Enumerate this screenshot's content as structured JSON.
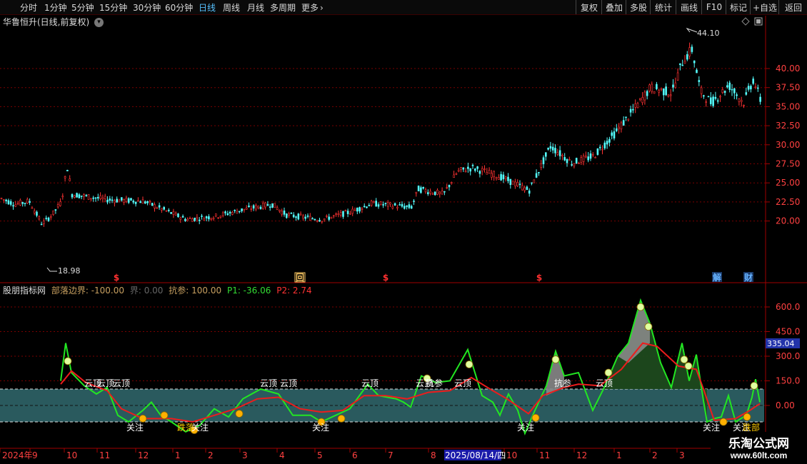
{
  "toolbar": {
    "periods": [
      {
        "label": "分时",
        "active": false
      },
      {
        "label": "1分钟",
        "active": false
      },
      {
        "label": "5分钟",
        "active": false
      },
      {
        "label": "15分钟",
        "active": false
      },
      {
        "label": "30分钟",
        "active": false
      },
      {
        "label": "60分钟",
        "active": false
      },
      {
        "label": "日线",
        "active": true
      },
      {
        "label": "周线",
        "active": false
      },
      {
        "label": "月线",
        "active": false
      },
      {
        "label": "多周期",
        "active": false
      },
      {
        "label": "更多",
        "active": false
      }
    ],
    "more_icon": "chevron-right-icon",
    "right_buttons": [
      "复权",
      "叠加",
      "多股",
      "统计",
      "画线",
      "F10",
      "标记",
      "+自选",
      "返回"
    ]
  },
  "main_chart": {
    "title": "华鲁恒升(日线,前复权)",
    "title_icon": "chevron-down-icon",
    "corner_icons": [
      "diamond-icon",
      "window-icon"
    ],
    "y_ticks": [
      "40.00",
      "37.50",
      "35.00",
      "32.50",
      "30.00",
      "27.50",
      "25.00",
      "22.50",
      "20.00"
    ],
    "high_label": "44.10",
    "low_label": "18.98",
    "markers": [
      {
        "symbol": "$",
        "color": "#ff3030"
      },
      {
        "symbol": "回",
        "color": "#ffcc66"
      },
      {
        "symbol": "$",
        "color": "#ff3030"
      },
      {
        "symbol": "$",
        "color": "#ff3030"
      },
      {
        "symbol": "解",
        "color": "#66b3ff"
      },
      {
        "symbol": "财",
        "color": "#66b3ff"
      }
    ],
    "colors": {
      "up": "#ff3232",
      "down": "#54fcfc",
      "grid": "#7a0000"
    }
  },
  "indicator": {
    "name": "股朋指标网",
    "params": [
      {
        "label": "部落边界: -100.00",
        "color": "#c8a060"
      },
      {
        "label": "界: 0.00",
        "color": "#666666"
      },
      {
        "label": "抗参: 100.00",
        "color": "#c8a060"
      },
      {
        "label": "P1: -36.06",
        "color": "#33dd33"
      },
      {
        "label": "P2: 2.74",
        "color": "#ff3333"
      }
    ],
    "y_ticks": [
      "600.0",
      "450.0",
      "300.0",
      "150.0",
      "0.00"
    ],
    "current_value": "335.04",
    "signals": [
      {
        "text": "云顶",
        "color": "#ffffff"
      },
      {
        "text": "云顶",
        "color": "#ffffff"
      },
      {
        "text": "云顶",
        "color": "#ffffff"
      },
      {
        "text": "云顶",
        "color": "#ffffff"
      },
      {
        "text": "云顶",
        "color": "#ffffff"
      },
      {
        "text": "云顶",
        "color": "#ffffff"
      },
      {
        "text": "云顶",
        "color": "#ffffff"
      },
      {
        "text": "云顶",
        "color": "#ffffff"
      },
      {
        "text": "云顶",
        "color": "#ffffff"
      },
      {
        "text": "抗参",
        "color": "#ffffff"
      },
      {
        "text": "抗参",
        "color": "#ffffff"
      },
      {
        "text": "关注",
        "color": "#ffffff"
      },
      {
        "text": "关注",
        "color": "#ffffff"
      },
      {
        "text": "跌落",
        "color": "#ffcc00"
      },
      {
        "text": "关注",
        "color": "#ffffff"
      },
      {
        "text": "关注",
        "color": "#ffffff"
      },
      {
        "text": "关注",
        "color": "#ffffff"
      },
      {
        "text": "关注",
        "color": "#ffffff"
      },
      {
        "text": "跌部",
        "color": "#ffcc00"
      }
    ]
  },
  "date_axis": {
    "labels": [
      "2024年",
      "9",
      "10",
      "11",
      "12",
      "1",
      "2",
      "3",
      "4",
      "5",
      "6",
      "7",
      "8",
      "2025/08/14/四",
      "10",
      "11",
      "12",
      "1",
      "2",
      "3"
    ],
    "cursor_label": "2025/08/14/四"
  },
  "brand": {
    "name": "乐淘公式网",
    "url": "www.60lt.com"
  }
}
